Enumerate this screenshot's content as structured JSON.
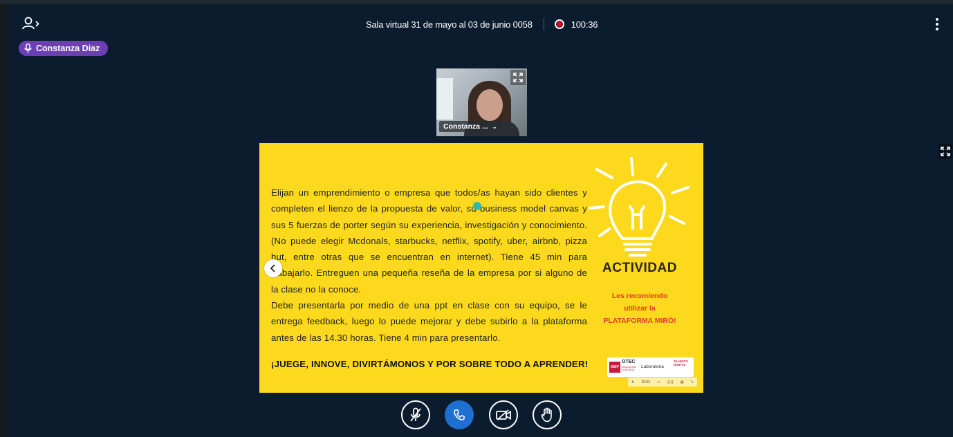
{
  "header": {
    "room_title": "Sala virtual 31 de mayo al 03 de junio 0058",
    "recording_time": "100:36",
    "users_icon": "user-list-toggle-icon",
    "options_icon": "kebab-menu-icon",
    "recording_icon": "recording-indicator-icon"
  },
  "talking_indicator": {
    "name": "Constanza Diaz",
    "icon": "microphone-icon",
    "color": "#6c3fb5"
  },
  "webcam": {
    "label": "Constanza ...",
    "expand_icon": "fullscreen-icon"
  },
  "presentation": {
    "paragraph1": "Elijan un emprendimiento o empresa que todos/as hayan sido clientes y completen el lienzo de la propuesta de valor, su business model canvas y sus 5 fuerzas de porter según su experiencia, investigación y conocimiento. (No puede elegir Mcdonals, starbucks, netflix, spotify, uber, airbnb, pizza hut, entre otras que se encuentran en internet). Tiene 45 min para trabajarlo. Entreguen una pequeña reseña de la empresa por si alguno de la clase no la conoce.",
    "paragraph2": "Debe presentarla por medio de una ppt en clase con su equipo, se le entrega feedback, luego lo puede mejorar y debe subirlo a la plataforma antes de las 14.30 horas. Tiene 4 min para presentarlo.",
    "closing": "¡JUEGE, INNOVE, DIVIRTÁMONOS Y POR SOBRE TODO A APRENDER!",
    "activity_title": "ACTIVIDAD",
    "note_line1": "Les recomiendo",
    "note_line2": "utilizar la",
    "note_line3": "PLATAFORMA MIRÓ!",
    "background_color": "#fcd91c",
    "logos": {
      "badge": "AIEP",
      "otec": "OTEC",
      "otec_sub": "EDUCACIÓN CONTINUA",
      "lab": "Laboratoria",
      "talent": "TALENTO DIGITAL"
    },
    "mini_toolbar": {
      "time": "25:22"
    },
    "prev_icon": "chevron-left-icon",
    "fullscreen_icon": "fullscreen-icon"
  },
  "controls": {
    "mute_icon": "microphone-off-icon",
    "audio_icon": "phone-icon",
    "camera_icon": "camera-off-icon",
    "raise_hand_icon": "hand-icon",
    "audio_color": "#1f6fd1"
  }
}
